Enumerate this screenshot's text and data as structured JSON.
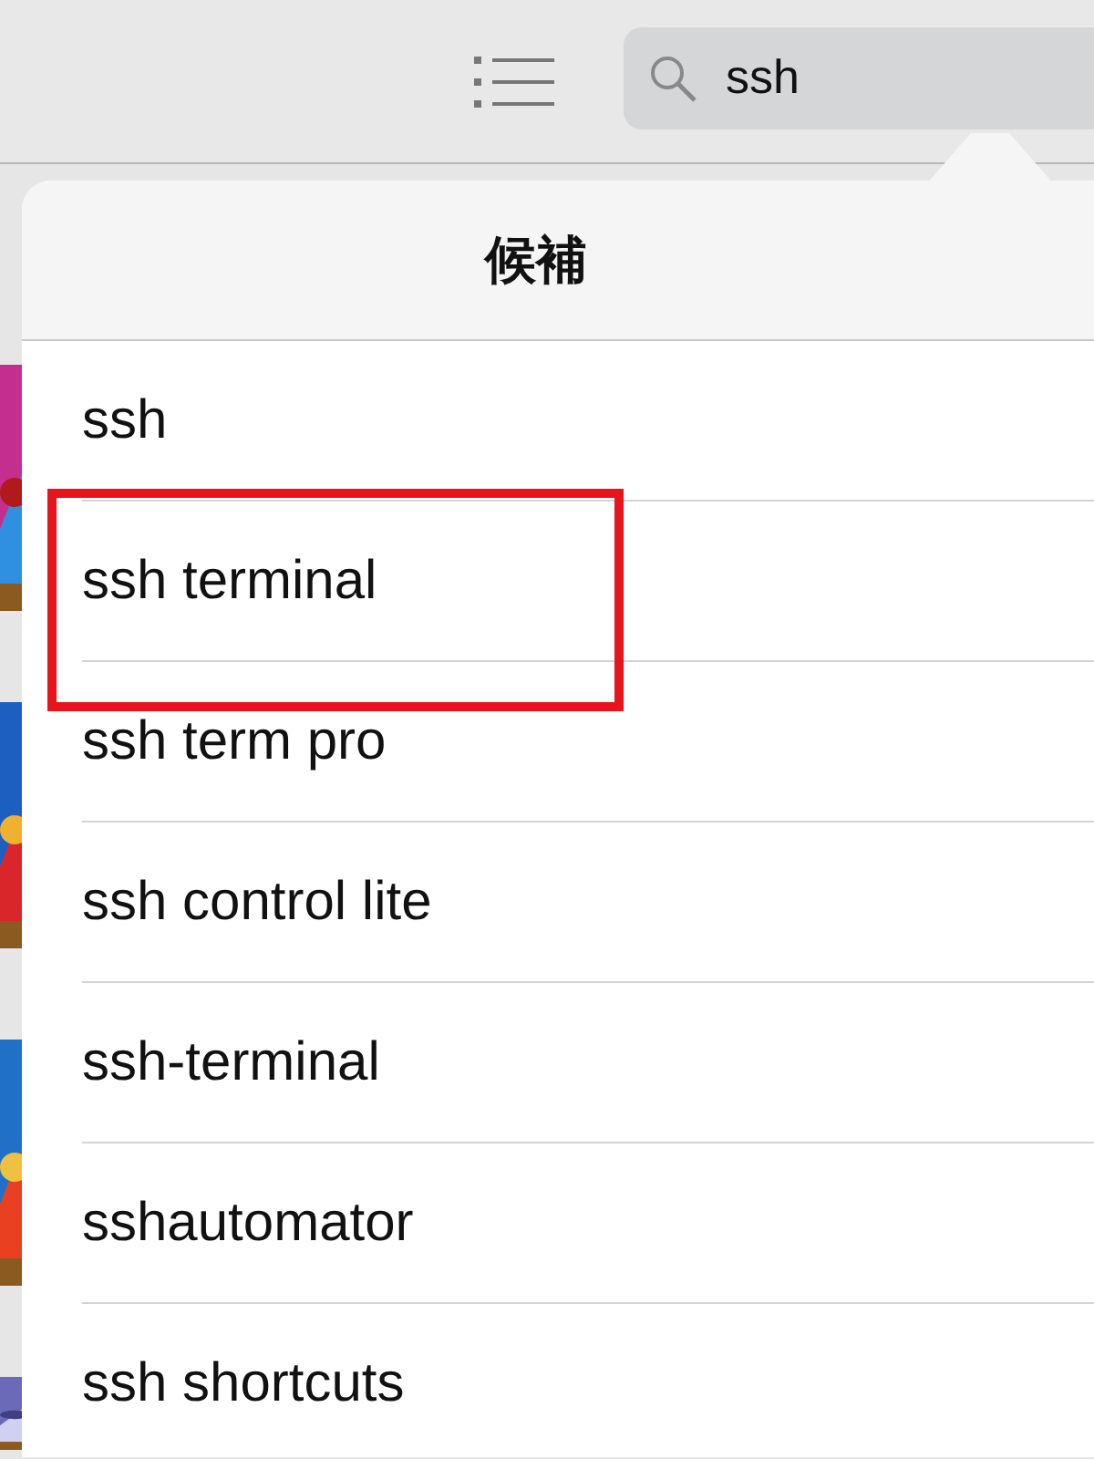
{
  "toolbar": {
    "search": {
      "value": "ssh"
    }
  },
  "popover": {
    "title": "候補",
    "suggestions": [
      {
        "label": "ssh",
        "highlighted": false
      },
      {
        "label": "ssh terminal",
        "highlighted": true
      },
      {
        "label": "ssh term pro",
        "highlighted": false
      },
      {
        "label": "ssh control lite",
        "highlighted": false
      },
      {
        "label": "ssh-terminal",
        "highlighted": false
      },
      {
        "label": "sshautomator",
        "highlighted": false
      },
      {
        "label": "ssh shortcuts",
        "highlighted": false
      }
    ]
  }
}
